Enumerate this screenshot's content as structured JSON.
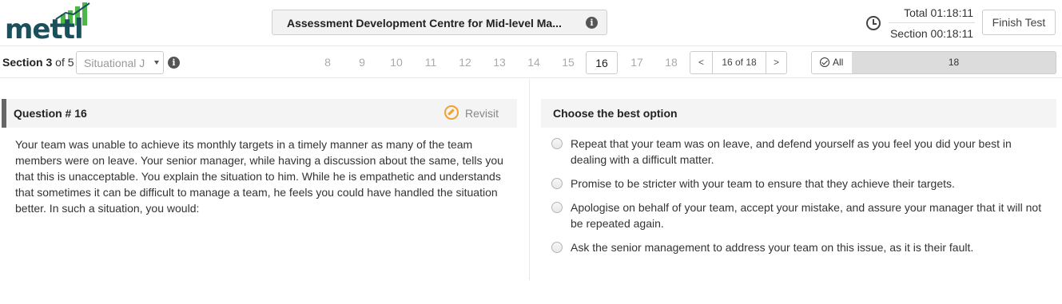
{
  "header": {
    "logo_text": "mettl",
    "title": "Assessment Development Centre for Mid-level Ma...",
    "timer_total": "Total 01:18:11",
    "timer_section": "Section 00:18:11",
    "finish_label": "Finish Test"
  },
  "nav": {
    "section_word": "Section",
    "section_current": "3",
    "section_of": "of 5",
    "section_select_value": "Situational J",
    "question_numbers": [
      "8",
      "9",
      "10",
      "11",
      "12",
      "13",
      "14",
      "15",
      "16",
      "17",
      "18"
    ],
    "active_question": "16",
    "pager_prev": "<",
    "pager_label": "16 of 18",
    "pager_next": ">",
    "filter_all_label": "All",
    "filter_count": "18"
  },
  "question": {
    "title": "Question # 16",
    "revisit_label": "Revisit",
    "text": "Your team was unable to achieve its monthly targets in a timely manner as many of the team members were on leave. Your senior manager, while having a discussion about the same, tells you that this is unacceptable. You explain the situation to him. While he is empathetic and understands that sometimes it can be difficult to manage a team, he feels you could have handled the situation better. In such a situation, you would:"
  },
  "options": {
    "title": "Choose the best option",
    "items": [
      {
        "text": "Repeat that your team was on leave, and defend yourself as you feel you did your best in dealing with a difficult matter."
      },
      {
        "text": "Promise to be stricter with your team to ensure that they achieve their targets."
      },
      {
        "text": "Apologise on behalf of your team, accept your mistake, and assure your manager that it will not be repeated again."
      },
      {
        "text": "Ask the senior management  to address your team on this issue, as it is their fault."
      }
    ]
  },
  "colors": {
    "logo": "#1a4f5c",
    "logo_bars": "#4cb848",
    "revisit_accent": "#f0a030",
    "question_bar": "#666666"
  },
  "icons": [
    "mettl-logo",
    "info-icon",
    "clock-icon",
    "check-circle-icon",
    "revisit-icon",
    "radio-icon"
  ]
}
